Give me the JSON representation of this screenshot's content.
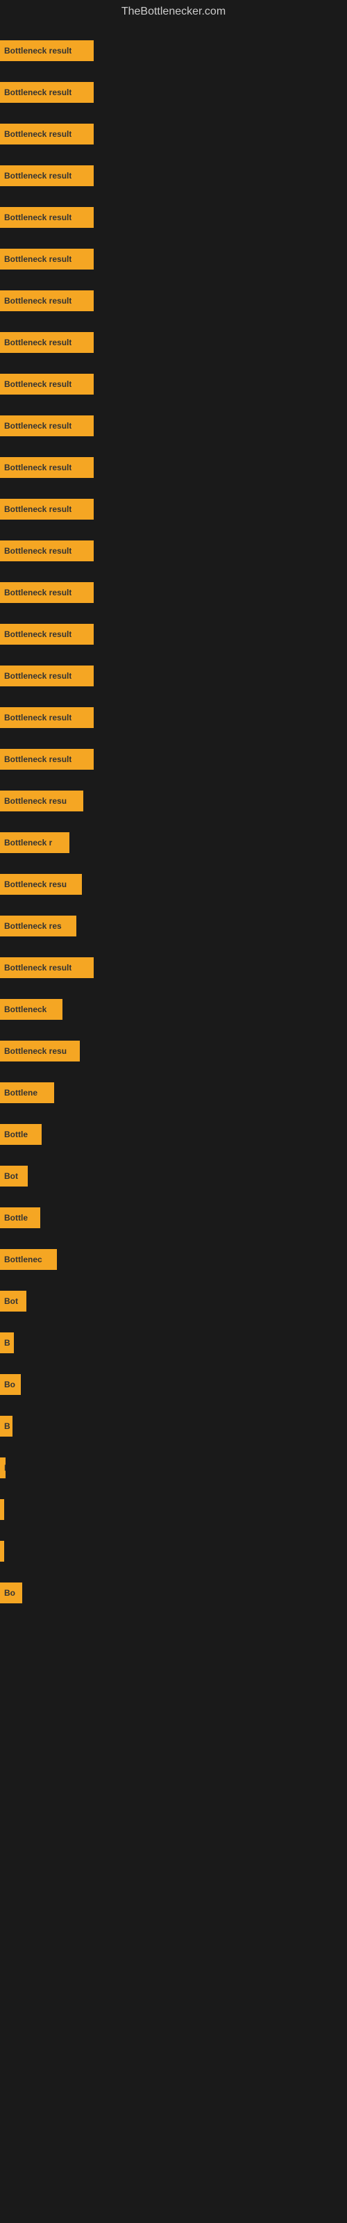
{
  "site": {
    "title": "TheBottlenecker.com"
  },
  "bars": [
    {
      "label": "Bottleneck result",
      "width": 135
    },
    {
      "label": "Bottleneck result",
      "width": 135
    },
    {
      "label": "Bottleneck result",
      "width": 135
    },
    {
      "label": "Bottleneck result",
      "width": 135
    },
    {
      "label": "Bottleneck result",
      "width": 135
    },
    {
      "label": "Bottleneck result",
      "width": 135
    },
    {
      "label": "Bottleneck result",
      "width": 135
    },
    {
      "label": "Bottleneck result",
      "width": 135
    },
    {
      "label": "Bottleneck result",
      "width": 135
    },
    {
      "label": "Bottleneck result",
      "width": 135
    },
    {
      "label": "Bottleneck result",
      "width": 135
    },
    {
      "label": "Bottleneck result",
      "width": 135
    },
    {
      "label": "Bottleneck result",
      "width": 135
    },
    {
      "label": "Bottleneck result",
      "width": 135
    },
    {
      "label": "Bottleneck result",
      "width": 135
    },
    {
      "label": "Bottleneck result",
      "width": 135
    },
    {
      "label": "Bottleneck result",
      "width": 135
    },
    {
      "label": "Bottleneck result",
      "width": 135
    },
    {
      "label": "Bottleneck resu",
      "width": 120
    },
    {
      "label": "Bottleneck r",
      "width": 100
    },
    {
      "label": "Bottleneck resu",
      "width": 118
    },
    {
      "label": "Bottleneck res",
      "width": 110
    },
    {
      "label": "Bottleneck result",
      "width": 135
    },
    {
      "label": "Bottleneck",
      "width": 90
    },
    {
      "label": "Bottleneck resu",
      "width": 115
    },
    {
      "label": "Bottlene",
      "width": 78
    },
    {
      "label": "Bottle",
      "width": 60
    },
    {
      "label": "Bot",
      "width": 40
    },
    {
      "label": "Bottle",
      "width": 58
    },
    {
      "label": "Bottlenec",
      "width": 82
    },
    {
      "label": "Bot",
      "width": 38
    },
    {
      "label": "B",
      "width": 20
    },
    {
      "label": "Bo",
      "width": 30
    },
    {
      "label": "B",
      "width": 18
    },
    {
      "label": "I",
      "width": 8
    },
    {
      "label": "",
      "width": 4
    },
    {
      "label": "",
      "width": 3
    },
    {
      "label": "Bo",
      "width": 32
    }
  ]
}
